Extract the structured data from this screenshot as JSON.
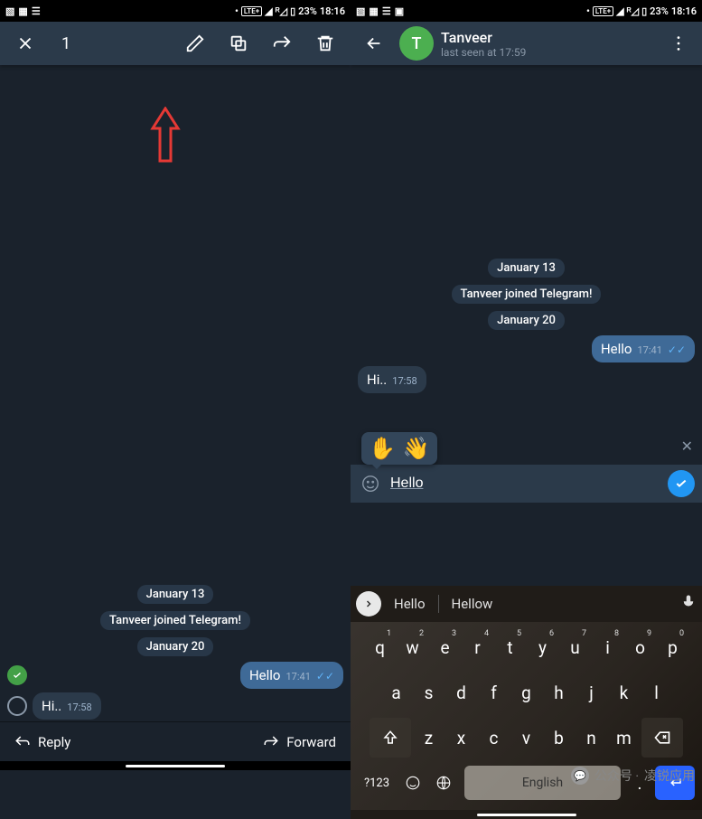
{
  "status": {
    "battery_pct": "23%",
    "time": "18:16",
    "lte": "LTE+"
  },
  "left": {
    "selection_count": "1",
    "dates": {
      "d1": "January 13",
      "d2": "January 20"
    },
    "system_msg": "Tanveer joined Telegram!",
    "msg_out": {
      "text": "Hello",
      "time": "17:41"
    },
    "msg_in": {
      "text": "Hi..",
      "time": "17:58"
    },
    "actions": {
      "reply": "Reply",
      "forward": "Forward"
    }
  },
  "right": {
    "header": {
      "name": "Tanveer",
      "status": "last seen at 17:59",
      "avatar_letter": "T"
    },
    "dates": {
      "d1": "January 13",
      "d2": "January 20"
    },
    "system_msg": "Tanveer joined Telegram!",
    "msg_out": {
      "text": "Hello",
      "time": "17:41"
    },
    "msg_in": {
      "text": "Hi..",
      "time": "17:58"
    },
    "edit": {
      "value": "Hello",
      "emoji1": "✋",
      "emoji2": "👋"
    },
    "suggestions": {
      "s1": "Hello",
      "s2": "Hellow"
    },
    "keyboard": {
      "row1_sup": [
        "1",
        "2",
        "3",
        "4",
        "5",
        "6",
        "7",
        "8",
        "9",
        "0"
      ],
      "row1": [
        "q",
        "w",
        "e",
        "r",
        "t",
        "y",
        "u",
        "i",
        "o",
        "p"
      ],
      "row2": [
        "a",
        "s",
        "d",
        "f",
        "g",
        "h",
        "j",
        "k",
        "l"
      ],
      "row3": [
        "z",
        "x",
        "c",
        "v",
        "b",
        "n",
        "m"
      ],
      "sym_key": "?123",
      "space_label": "English",
      "dot": "."
    }
  },
  "watermark": {
    "prefix": "公众号 ·",
    "name": "凌锐应用"
  }
}
